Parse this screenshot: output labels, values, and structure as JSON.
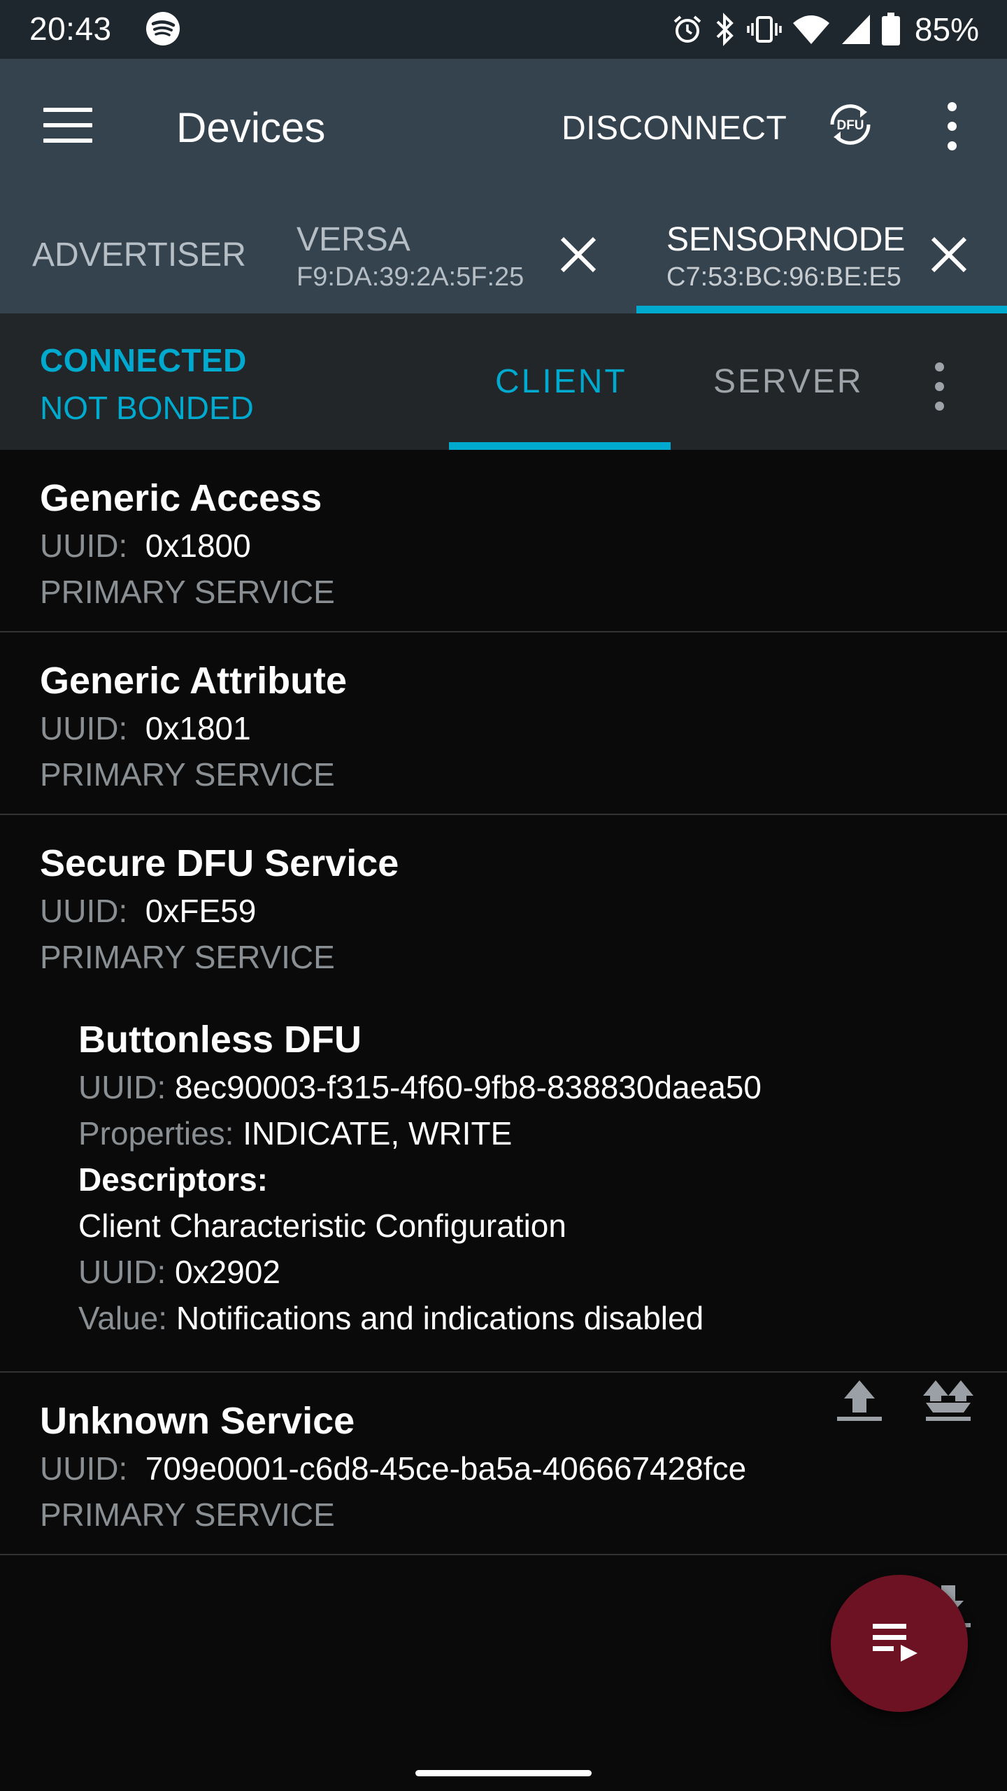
{
  "status_bar": {
    "time": "20:43",
    "battery": "85%",
    "icons": [
      "spotify-icon",
      "alarm-icon",
      "bluetooth-icon",
      "vibrate-icon",
      "wifi-icon",
      "signal-icon",
      "battery-icon"
    ]
  },
  "toolbar": {
    "title": "Devices",
    "disconnect_label": "DISCONNECT",
    "dfu_label": "DFU"
  },
  "device_tabs": [
    {
      "name": "ADVERTISER"
    },
    {
      "name": "VERSA",
      "address": "F9:DA:39:2A:5F:25"
    },
    {
      "name": "SENSORNODE",
      "address": "C7:53:BC:96:BE:E5",
      "selected": true
    }
  ],
  "connection": {
    "state": "CONNECTED",
    "bond": "NOT BONDED",
    "tabs": [
      {
        "label": "CLIENT",
        "selected": true
      },
      {
        "label": "SERVER",
        "selected": false
      }
    ]
  },
  "labels": {
    "uuid": "UUID:",
    "properties": "Properties:",
    "descriptors": "Descriptors:",
    "value": "Value:"
  },
  "services": [
    {
      "name": "Generic Access",
      "uuid": "0x1800",
      "type": "PRIMARY SERVICE"
    },
    {
      "name": "Generic Attribute",
      "uuid": "0x1801",
      "type": "PRIMARY SERVICE"
    },
    {
      "name": "Secure DFU Service",
      "uuid": "0xFE59",
      "type": "PRIMARY SERVICE",
      "characteristic": {
        "name": "Buttonless DFU",
        "uuid": "8ec90003-f315-4f60-9fb8-838830daea50",
        "properties": "INDICATE, WRITE",
        "descriptor": {
          "name": "Client Characteristic Configuration",
          "uuid": "0x2902",
          "value": "Notifications and indications disabled"
        }
      }
    },
    {
      "name": "Unknown Service",
      "uuid": "709e0001-c6d8-45ce-ba5a-406667428fce",
      "type": "PRIMARY SERVICE"
    }
  ],
  "colors": {
    "accent": "#00a9ce",
    "toolbar": "#35434f",
    "fab": "#6d1223"
  }
}
